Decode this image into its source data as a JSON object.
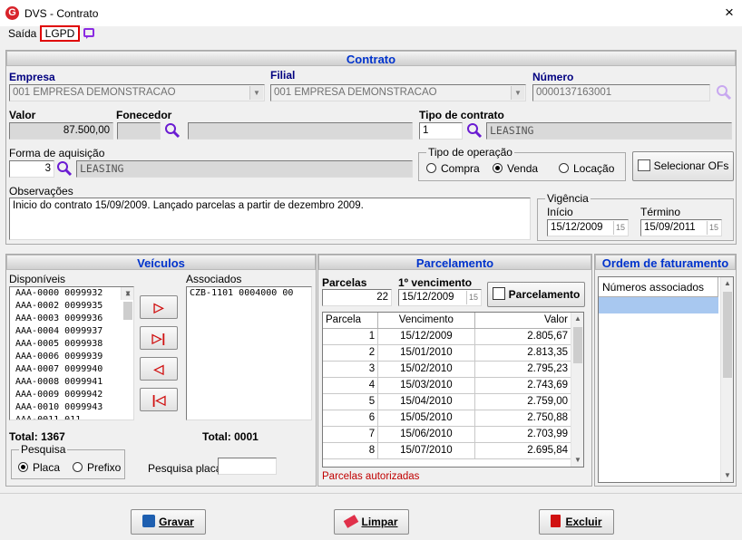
{
  "window": {
    "title": "DVS - Contrato",
    "close": "×",
    "app_icon_letter": "G"
  },
  "menu": {
    "saida": "Saída",
    "lgpd": "LGPD"
  },
  "contrato": {
    "header": "Contrato",
    "empresa_label": "Empresa",
    "empresa_value": "001 EMPRESA DEMONSTRACAO",
    "filial_label": "Filial",
    "filial_value": "001 EMPRESA DEMONSTRACAO",
    "numero_label": "Número",
    "numero_value": "0000137163001",
    "valor_label": "Valor",
    "valor_value": "87.500,00",
    "fornecedor_label": "Fonecedor",
    "fornecedor_code": "",
    "fornecedor_name": "",
    "tipo_contrato_label": "Tipo de contrato",
    "tipo_contrato_code": "1",
    "tipo_contrato_name": "LEASING",
    "forma_aquisicao_label": "Forma de aquisição",
    "forma_aquisicao_code": "3",
    "forma_aquisicao_name": "LEASING",
    "tipo_operacao_label": "Tipo de operação",
    "tipo_operacao_options": [
      "Compra",
      "Venda",
      "Locação"
    ],
    "tipo_operacao_selected": "Venda",
    "selecionar_ofs": "Selecionar OFs",
    "observacoes_label": "Observações",
    "observacoes_value": "Inicio do contrato 15/09/2009. Lançado parcelas a partir de dezembro 2009.",
    "vigencia_label": "Vigência",
    "inicio_label": "Início",
    "inicio_value": "15/12/2009",
    "termino_label": "Término",
    "termino_value": "15/09/2011",
    "date_btn": "15"
  },
  "veiculos": {
    "header": "Veículos",
    "disponiveis_label": "Disponíveis",
    "disponiveis": [
      "AAA-0000 0099932",
      "AAA-0002 0099935",
      "AAA-0003 0099936",
      "AAA-0004 0099937",
      "AAA-0005 0099938",
      "AAA-0006 0099939",
      "AAA-0007 0099940",
      "AAA-0008 0099941",
      "AAA-0009 0099942",
      "AAA-0010 0099943",
      "AAA-0011 011"
    ],
    "associados_label": "Associados",
    "associados": [
      "CZB-1101 0004000 00"
    ],
    "total_disp": "Total: 1367",
    "total_assoc": "Total: 0001",
    "pesquisa_label": "Pesquisa",
    "pesquisa_options": [
      "Placa",
      "Prefixo"
    ],
    "pesquisa_selected": "Placa",
    "pesquisa_placa_label": "Pesquisa placa",
    "pesquisa_placa_value": ""
  },
  "parcelamento": {
    "header": "Parcelamento",
    "parcelas_label": "Parcelas",
    "parcelas_value": "22",
    "primeiro_venc_label": "1º vencimento",
    "primeiro_venc_value": "15/12/2009",
    "button": "Parcelamento",
    "columns": [
      "Parcela",
      "Vencimento",
      "Valor"
    ],
    "rows": [
      [
        "1",
        "15/12/2009",
        "2.805,67"
      ],
      [
        "2",
        "15/01/2010",
        "2.813,35"
      ],
      [
        "3",
        "15/02/2010",
        "2.795,23"
      ],
      [
        "4",
        "15/03/2010",
        "2.743,69"
      ],
      [
        "5",
        "15/04/2010",
        "2.759,00"
      ],
      [
        "6",
        "15/05/2010",
        "2.750,88"
      ],
      [
        "7",
        "15/06/2010",
        "2.703,99"
      ],
      [
        "8",
        "15/07/2010",
        "2.695,84"
      ]
    ],
    "status": "Parcelas autorizadas",
    "status_color": "#c00000"
  },
  "ordem": {
    "header": "Ordem de faturamento",
    "column": "Números associados"
  },
  "footer": {
    "gravar": "Gravar",
    "limpar": "Limpar",
    "excluir": "Excluir"
  },
  "colors": {
    "header_text": "#0033cc",
    "accent_red": "#d01010",
    "magnifier": "#7a2be2",
    "selection": "#a8c8f0"
  },
  "icons": [
    "app-logo-icon",
    "close-icon",
    "chat-icon",
    "search-icon",
    "calendar-icon",
    "list-icon",
    "save-icon",
    "eraser-icon",
    "trash-icon",
    "arrow-right-icon",
    "arrow-right-all-icon",
    "arrow-left-icon",
    "arrow-left-all-icon"
  ]
}
